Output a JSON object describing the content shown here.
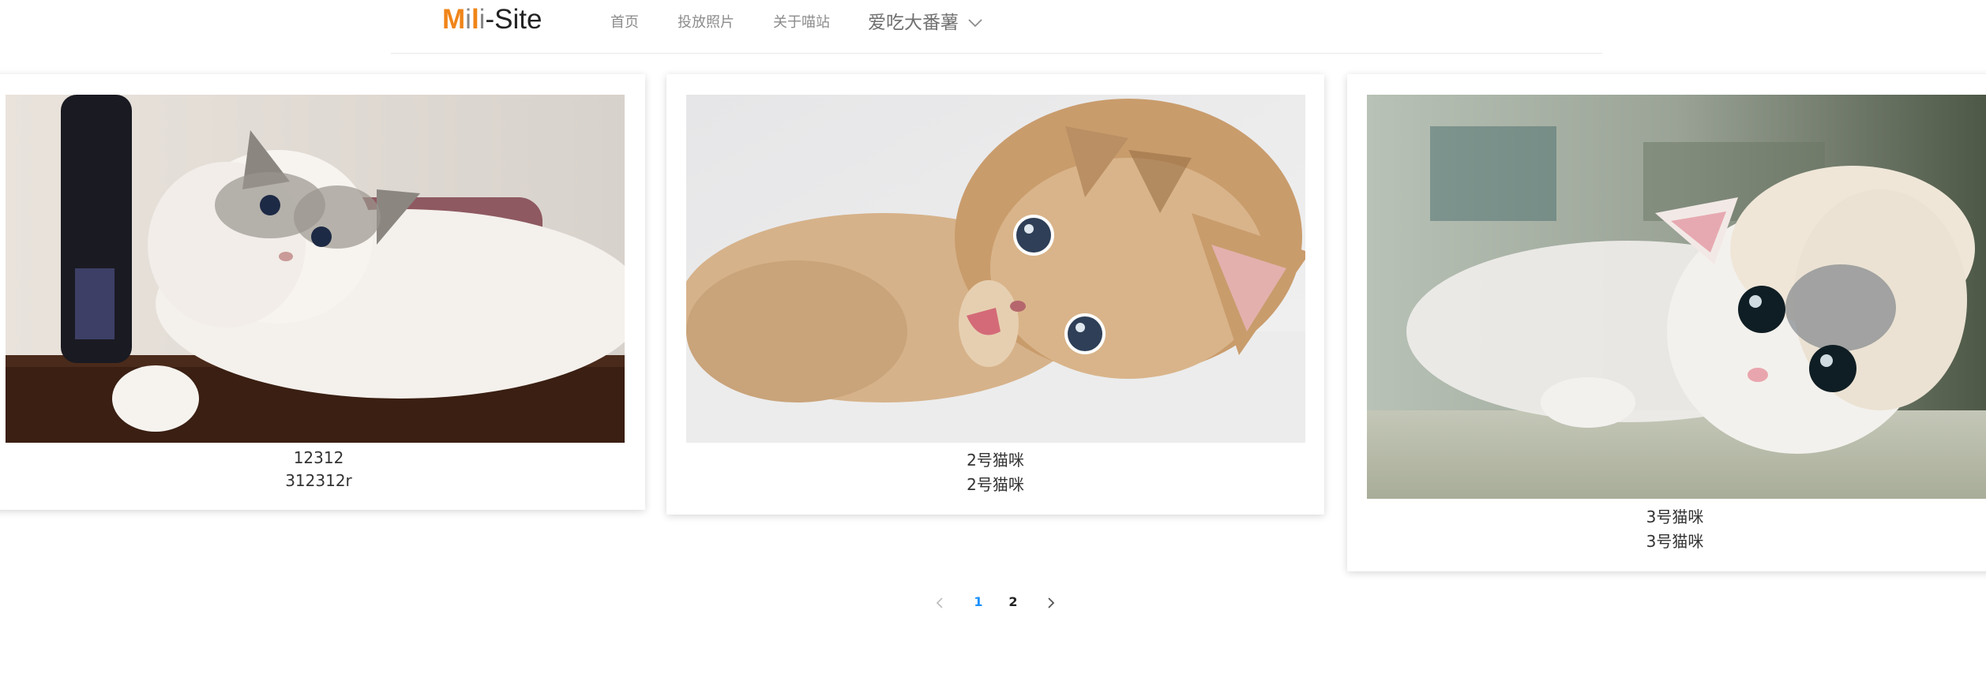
{
  "brand": {
    "logo_m": "M",
    "logo_i1": "i",
    "logo_l": "l",
    "logo_i2": "i",
    "logo_rest": "-Site"
  },
  "nav": {
    "items": [
      {
        "label": "首页"
      },
      {
        "label": "投放照片"
      },
      {
        "label": "关于喵站"
      }
    ],
    "user": "爱吃大番薯"
  },
  "cards": [
    {
      "line1": "12312",
      "line2": "312312r",
      "image": "ragdoll cat lying on wooden table"
    },
    {
      "line1": "2号猫咪",
      "line2": "2号猫咪",
      "image": "tabby kitten licking paw"
    },
    {
      "line1": "3号猫咪",
      "line2": "3号猫咪",
      "image": "white kitten wearing knit hat"
    }
  ],
  "pagination": {
    "prev_icon": "chevron-left-icon",
    "pages": [
      "1",
      "2"
    ],
    "current": "1",
    "next_icon": "chevron-right-icon"
  },
  "colors": {
    "brand_orange": "#f08519",
    "active_page": "#1890ff"
  }
}
